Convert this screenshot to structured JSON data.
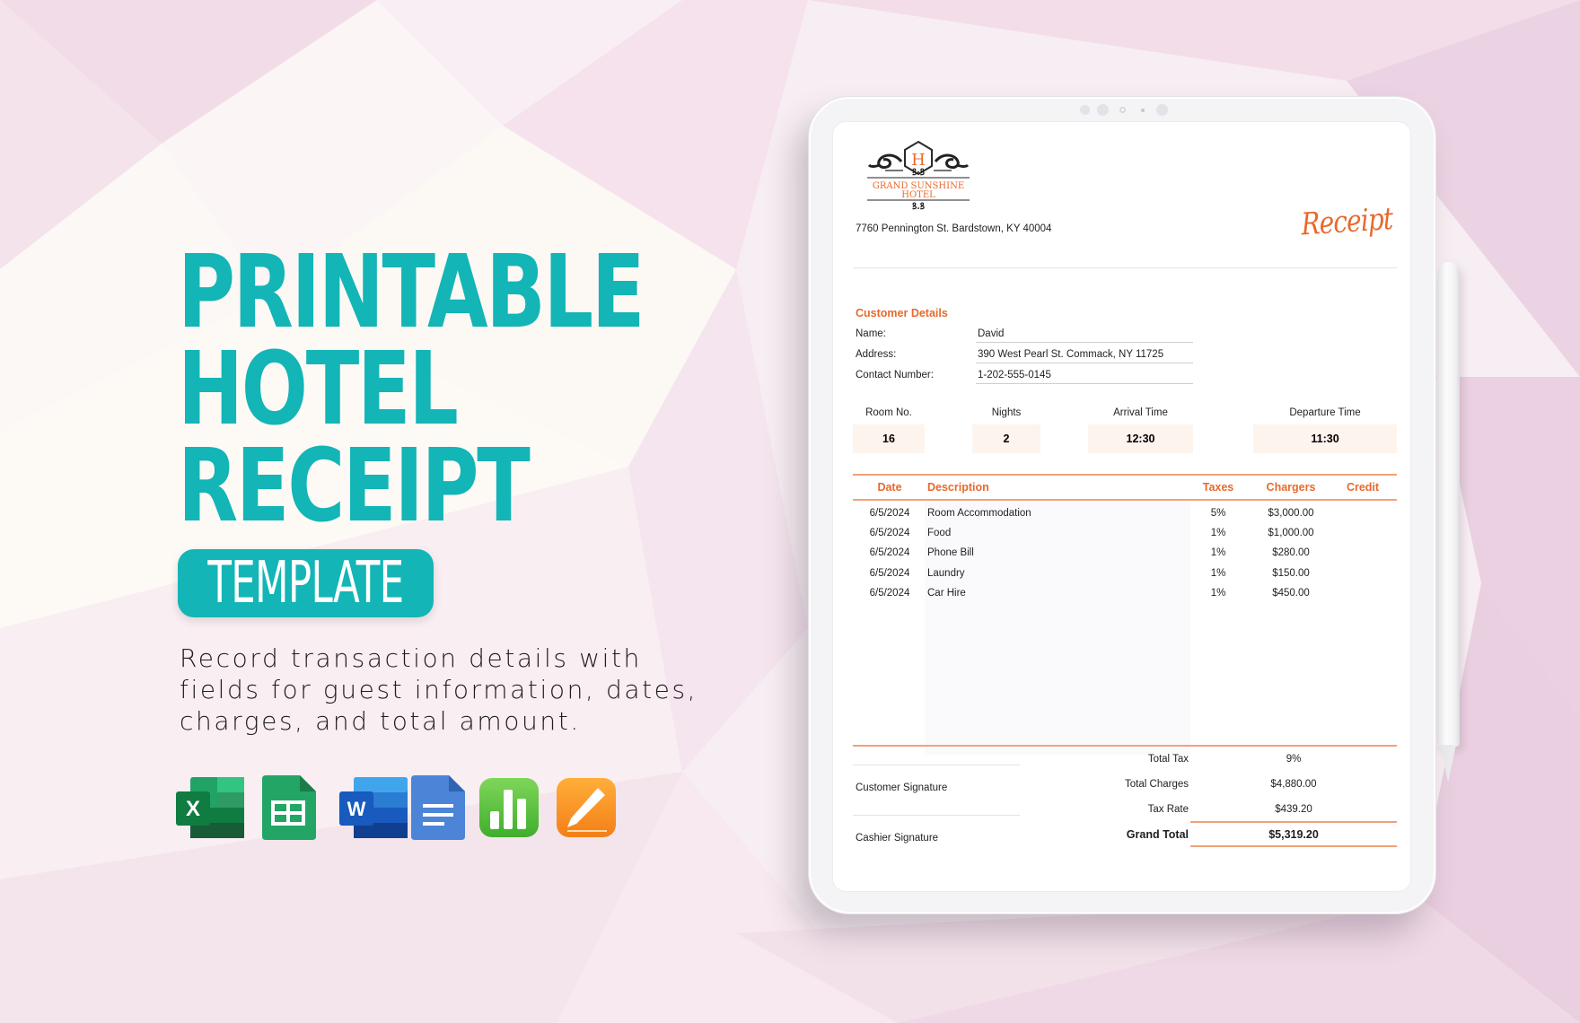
{
  "promo": {
    "title_lines": [
      "PRINTABLE",
      "HOTEL",
      "RECEIPT"
    ],
    "pill_label": "TEMPLATE",
    "description_lines": [
      "Record transaction details with",
      "fields for guest information, dates,",
      "charges, and total amount."
    ],
    "app_icons": [
      {
        "name": "excel-icon",
        "letter": "X"
      },
      {
        "name": "google-sheets-icon"
      },
      {
        "name": "word-icon",
        "letter": "W"
      },
      {
        "name": "google-docs-icon"
      },
      {
        "name": "numbers-icon"
      },
      {
        "name": "pages-icon"
      }
    ],
    "accent_color": "#13b5b6"
  },
  "receipt": {
    "hotel": {
      "logo_letter": "H",
      "name_line1": "GRAND SUNSHINE",
      "name_line2": "HOTEL",
      "address": "7760 Pennington St. Bardstown, KY 40004"
    },
    "heading": "Receipt",
    "accent_color": "#e8692c",
    "customer": {
      "section_title": "Customer Details",
      "fields": [
        {
          "label": "Name:",
          "value": "David"
        },
        {
          "label": "Address:",
          "value": "390 West Pearl St. Commack, NY 11725"
        },
        {
          "label": "Contact Number:",
          "value": "1-202-555-0145"
        }
      ]
    },
    "stay": [
      {
        "label": "Room No.",
        "value": "16"
      },
      {
        "label": "Nights",
        "value": "2"
      },
      {
        "label": "Arrival Time",
        "value": "12:30"
      },
      {
        "label": "Departure Time",
        "value": "11:30"
      }
    ],
    "table": {
      "headers": {
        "date": "Date",
        "description": "Description",
        "taxes": "Taxes",
        "charges": "Chargers",
        "credit": "Credit"
      },
      "rows": [
        {
          "date": "6/5/2024",
          "description": "Room Accommodation",
          "taxes": "5%",
          "charges": "$3,000.00",
          "credit": ""
        },
        {
          "date": "6/5/2024",
          "description": "Food",
          "taxes": "1%",
          "charges": "$1,000.00",
          "credit": ""
        },
        {
          "date": "6/5/2024",
          "description": "Phone Bill",
          "taxes": "1%",
          "charges": "$280.00",
          "credit": ""
        },
        {
          "date": "6/5/2024",
          "description": "Laundry",
          "taxes": "1%",
          "charges": "$150.00",
          "credit": ""
        },
        {
          "date": "6/5/2024",
          "description": "Car Hire",
          "taxes": "1%",
          "charges": "$450.00",
          "credit": ""
        }
      ]
    },
    "signatures": {
      "customer": "Customer Signature",
      "cashier": "Cashier Signature"
    },
    "summary": {
      "total_tax_label": "Total Tax",
      "total_tax": "9%",
      "total_charges_label": "Total Charges",
      "total_charges": "$4,880.00",
      "tax_rate_label": "Tax Rate",
      "tax_rate": "$439.20",
      "grand_total_label": "Grand Total",
      "grand_total": "$5,319.20"
    }
  }
}
